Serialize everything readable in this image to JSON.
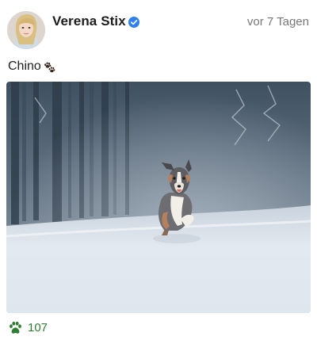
{
  "post": {
    "author_name": "Verena Stix",
    "author_verified": true,
    "timestamp": "vor 7 Tagen",
    "caption": "Chino",
    "caption_icon": "paw-prints-icon",
    "photo": {
      "alt": "Dog running through snow"
    },
    "likes": {
      "icon": "paw-icon",
      "count": "107",
      "color": "#2e7d32"
    }
  },
  "colors": {
    "verified_badge": "#2f80ed",
    "timestamp": "#777777",
    "like_accent": "#2e7d32"
  }
}
